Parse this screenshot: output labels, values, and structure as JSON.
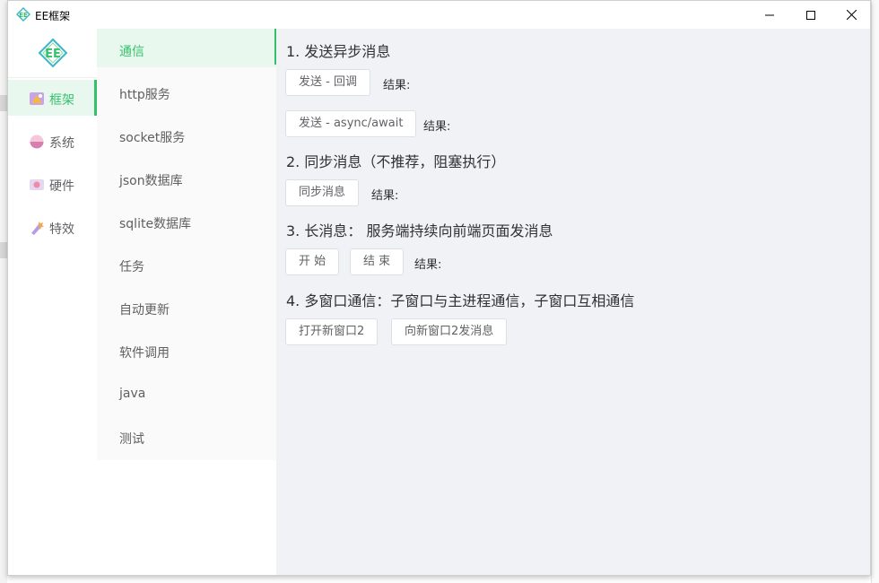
{
  "window": {
    "title": "EE框架"
  },
  "nav1": {
    "items": [
      {
        "label": "框架",
        "active": true
      },
      {
        "label": "系统",
        "active": false
      },
      {
        "label": "硬件",
        "active": false
      },
      {
        "label": "特效",
        "active": false
      }
    ]
  },
  "nav2": {
    "items": [
      {
        "label": "通信",
        "active": true
      },
      {
        "label": "http服务"
      },
      {
        "label": "socket服务"
      },
      {
        "label": "json数据库"
      },
      {
        "label": "sqlite数据库"
      },
      {
        "label": "任务"
      },
      {
        "label": "自动更新"
      },
      {
        "label": "软件调用"
      },
      {
        "label": "java"
      },
      {
        "label": "测试"
      }
    ]
  },
  "content": {
    "section1": {
      "title": "1. 发送异步消息",
      "btn_callback": "发送 - 回调",
      "result1": "结果:",
      "btn_async": "发送 - async/await",
      "result2": "结果:"
    },
    "section2": {
      "title": "2. 同步消息（不推荐，阻塞执行）",
      "btn_sync": "同步消息",
      "result": "结果:"
    },
    "section3": {
      "title": "3. 长消息： 服务端持续向前端页面发消息",
      "btn_start": "开 始",
      "btn_end": "结 束",
      "result": "结果:"
    },
    "section4": {
      "title": "4. 多窗口通信：子窗口与主进程通信，子窗口互相通信",
      "btn_open": "打开新窗口2",
      "btn_send": "向新窗口2发消息"
    }
  },
  "colors": {
    "accent": "#35c16b",
    "content_bg": "#f0f2f5"
  }
}
